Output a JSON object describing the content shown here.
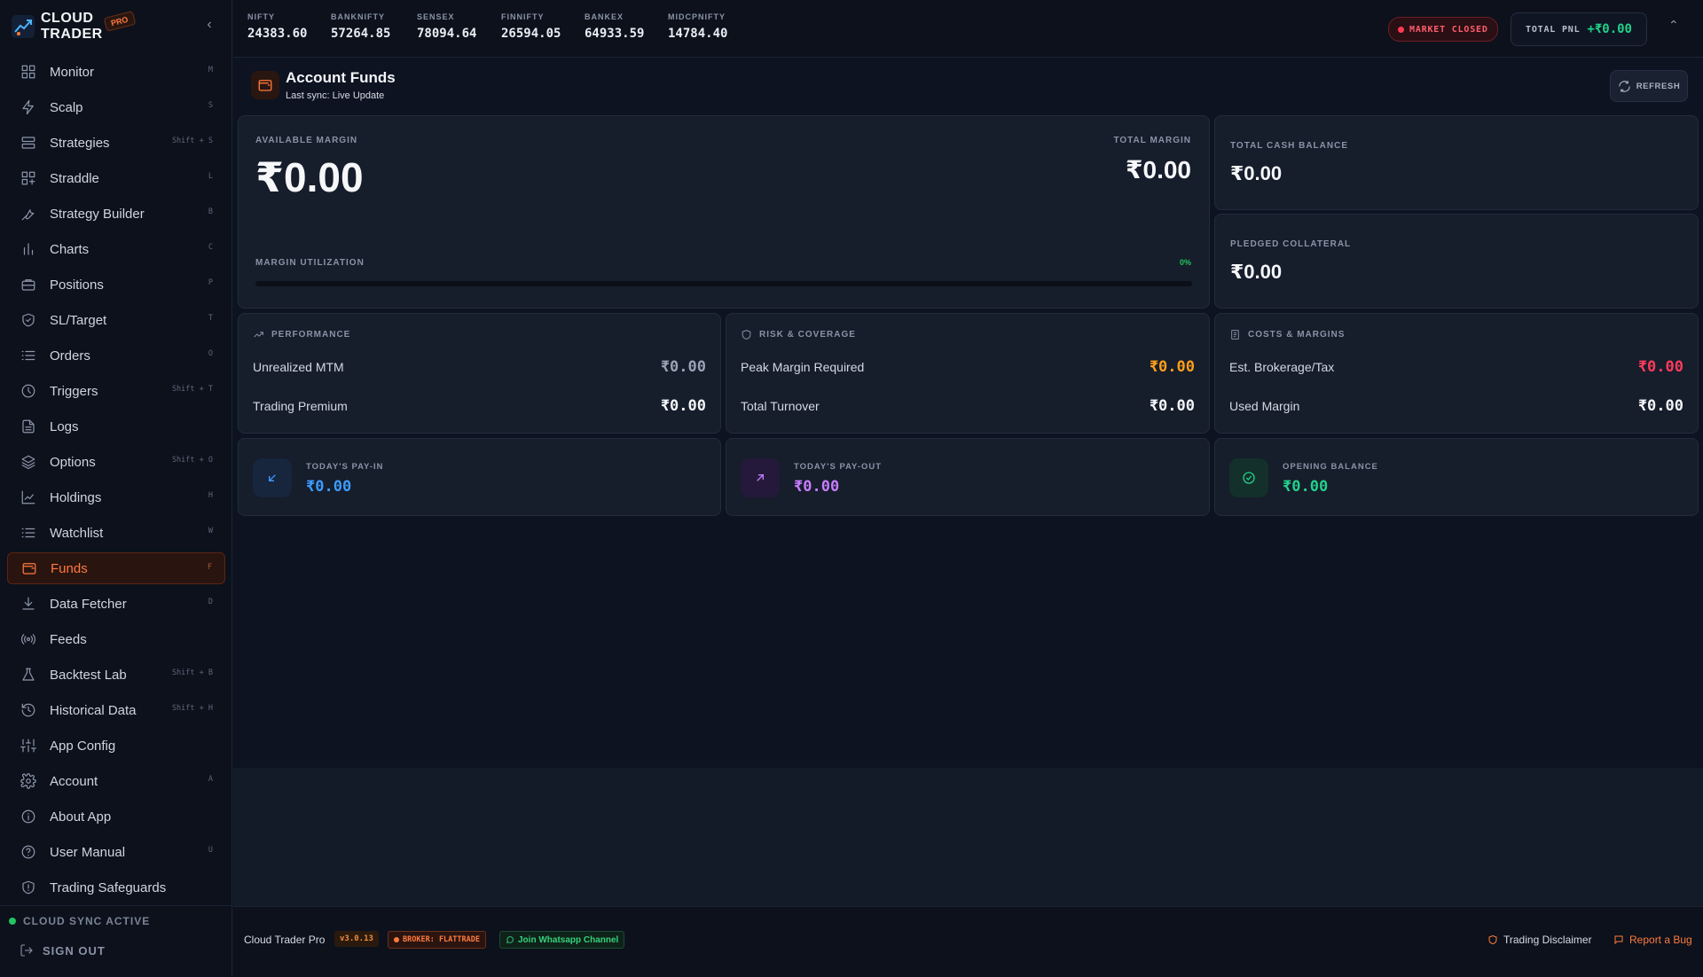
{
  "brand": {
    "line1": "CLOUD",
    "line2": "TRADER",
    "badge": "PRO"
  },
  "nav": [
    {
      "label": "Monitor",
      "key": "M",
      "icon": "grid-icon"
    },
    {
      "label": "Scalp",
      "key": "S",
      "icon": "zap-icon"
    },
    {
      "label": "Strategies",
      "key": "Shift + S",
      "icon": "layers-icon"
    },
    {
      "label": "Straddle",
      "key": "L",
      "icon": "straddle-icon"
    },
    {
      "label": "Strategy Builder",
      "key": "B",
      "icon": "wrench-icon"
    },
    {
      "label": "Charts",
      "key": "C",
      "icon": "bar-chart-icon"
    },
    {
      "label": "Positions",
      "key": "P",
      "icon": "briefcase-icon"
    },
    {
      "label": "SL/Target",
      "key": "T",
      "icon": "shield-icon"
    },
    {
      "label": "Orders",
      "key": "O",
      "icon": "list-icon"
    },
    {
      "label": "Triggers",
      "key": "Shift + T",
      "icon": "clock-icon"
    },
    {
      "label": "Logs",
      "key": "",
      "icon": "file-icon"
    },
    {
      "label": "Options",
      "key": "Shift + O",
      "icon": "stack-icon"
    },
    {
      "label": "Holdings",
      "key": "H",
      "icon": "line-chart-icon"
    },
    {
      "label": "Watchlist",
      "key": "W",
      "icon": "watchlist-icon"
    },
    {
      "label": "Funds",
      "key": "F",
      "icon": "wallet-icon",
      "active": true
    },
    {
      "label": "Data Fetcher",
      "key": "D",
      "icon": "download-icon"
    },
    {
      "label": "Feeds",
      "key": "",
      "icon": "broadcast-icon"
    },
    {
      "label": "Backtest Lab",
      "key": "Shift + B",
      "icon": "flask-icon"
    },
    {
      "label": "Historical Data",
      "key": "Shift + H",
      "icon": "history-icon"
    },
    {
      "label": "App Config",
      "key": "",
      "icon": "sliders-icon"
    },
    {
      "label": "Account",
      "key": "A",
      "icon": "gear-icon"
    },
    {
      "label": "About App",
      "key": "",
      "icon": "info-icon"
    },
    {
      "label": "User Manual",
      "key": "U",
      "icon": "help-icon"
    },
    {
      "label": "Trading Safeguards",
      "key": "",
      "icon": "safeguard-icon"
    }
  ],
  "sidebar_footer": {
    "sync": "CLOUD SYNC ACTIVE",
    "sign_out": "SIGN OUT"
  },
  "tickers": [
    {
      "name": "NIFTY",
      "value": "24383.60"
    },
    {
      "name": "BANKNIFTY",
      "value": "57264.85"
    },
    {
      "name": "SENSEX",
      "value": "78094.64"
    },
    {
      "name": "FINNIFTY",
      "value": "26594.05"
    },
    {
      "name": "BANKEX",
      "value": "64933.59"
    },
    {
      "name": "MIDCPNIFTY",
      "value": "14784.40"
    }
  ],
  "market_status": "MARKET CLOSED",
  "pnl": {
    "label": "TOTAL PNL",
    "value": "+₹0.00"
  },
  "page": {
    "title": "Account Funds",
    "subtitle": "Last sync: Live Update",
    "refresh": "REFRESH"
  },
  "margin": {
    "available_label": "AVAILABLE MARGIN",
    "available_value": "₹0.00",
    "total_label": "TOTAL MARGIN",
    "total_value": "₹0.00",
    "util_label": "MARGIN UTILIZATION",
    "util_pct": "0%",
    "util_fraction": 0
  },
  "cash": {
    "label": "TOTAL CASH BALANCE",
    "value": "₹0.00"
  },
  "collateral": {
    "label": "PLEDGED COLLATERAL",
    "value": "₹0.00"
  },
  "performance": {
    "title": "PERFORMANCE",
    "rows": [
      {
        "label": "Unrealized MTM",
        "value": "₹0.00"
      },
      {
        "label": "Trading Premium",
        "value": "₹0.00"
      }
    ]
  },
  "risk": {
    "title": "RISK & COVERAGE",
    "rows": [
      {
        "label": "Peak Margin Required",
        "value": "₹0.00"
      },
      {
        "label": "Total Turnover",
        "value": "₹0.00"
      }
    ]
  },
  "costs": {
    "title": "COSTS & MARGINS",
    "rows": [
      {
        "label": "Est. Brokerage/Tax",
        "value": "₹0.00"
      },
      {
        "label": "Used Margin",
        "value": "₹0.00"
      }
    ]
  },
  "payin": {
    "label": "TODAY'S PAY-IN",
    "value": "₹0.00"
  },
  "payout": {
    "label": "TODAY'S PAY-OUT",
    "value": "₹0.00"
  },
  "opening": {
    "label": "OPENING BALANCE",
    "value": "₹0.00"
  },
  "footer": {
    "app": "Cloud Trader Pro",
    "version": "v3.0.13",
    "broker": "BROKER: FLATTRADE",
    "whatsapp": "Join Whatsapp Channel",
    "disclaimer": "Trading Disclaimer",
    "bug": "Report a Bug"
  },
  "colors": {
    "accent": "#ff7a3d",
    "positive": "#22d18b",
    "negative": "#ff3b5c",
    "warning": "#ff9f1a",
    "payin": "#3b9cff",
    "payout": "#c77dff"
  }
}
